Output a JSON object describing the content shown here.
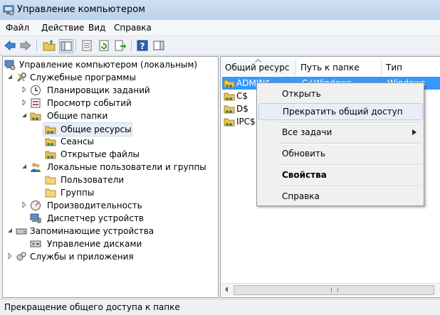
{
  "window": {
    "title": "Управление компьютером"
  },
  "menubar": {
    "items": [
      "Файл",
      "Действие",
      "Вид",
      "Справка"
    ]
  },
  "toolbar": {
    "buttons": [
      "back-arrow-icon",
      "forward-arrow-icon",
      "up-folder-icon",
      "show-hide-tree-icon",
      "properties-icon",
      "refresh-icon",
      "export-list-icon",
      "help-icon",
      "show-action-pane-icon"
    ]
  },
  "tree": {
    "root": "Управление компьютером (локальным)",
    "items": [
      {
        "label": "Служебные программы"
      },
      {
        "label": "Планировщик заданий"
      },
      {
        "label": "Просмотр событий"
      },
      {
        "label": "Общие папки"
      },
      {
        "label": "Общие ресурсы"
      },
      {
        "label": "Сеансы"
      },
      {
        "label": "Открытые файлы"
      },
      {
        "label": "Локальные пользователи и группы"
      },
      {
        "label": "Пользователи"
      },
      {
        "label": "Группы"
      },
      {
        "label": "Производительность"
      },
      {
        "label": "Диспетчер устройств"
      },
      {
        "label": "Запоминающие устройства"
      },
      {
        "label": "Управление дисками"
      },
      {
        "label": "Службы и приложения"
      }
    ]
  },
  "list": {
    "columns": [
      "Общий ресурс",
      "Путь к папке",
      "Тип"
    ],
    "rows": [
      {
        "name": "ADMIN$",
        "path": "C:\\Windows",
        "type": "Windows"
      },
      {
        "name": "C$"
      },
      {
        "name": "D$"
      },
      {
        "name": "IPC$"
      }
    ]
  },
  "context_menu": {
    "items": [
      "Открыть",
      "Прекратить общий доступ",
      "Все задачи",
      "Обновить",
      "Свойства",
      "Справка"
    ]
  },
  "statusbar": {
    "text": "Прекращение общего доступа к папке"
  },
  "colors": {
    "selection": "#3399ff",
    "accent": "#1e5aa8"
  }
}
